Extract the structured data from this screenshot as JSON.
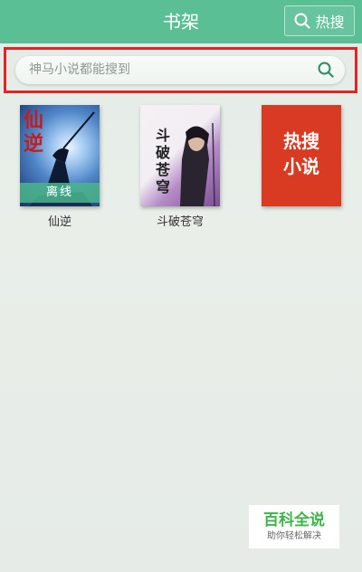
{
  "header": {
    "title": "书架",
    "hot_search_label": "热搜",
    "accent_color": "#5bbf96"
  },
  "search": {
    "placeholder": "神马小说都能搜到",
    "highlight_color": "#e42424"
  },
  "books": [
    {
      "title": "仙逆",
      "cover_text": "仙逆",
      "badge": "离线"
    },
    {
      "title": "斗破苍穹",
      "cover_text": "斗破苍穹"
    },
    {
      "title": "",
      "cover_text": "热搜小说"
    }
  ],
  "watermark": {
    "title": "百科全说",
    "subtitle": "助你轻松解决"
  }
}
